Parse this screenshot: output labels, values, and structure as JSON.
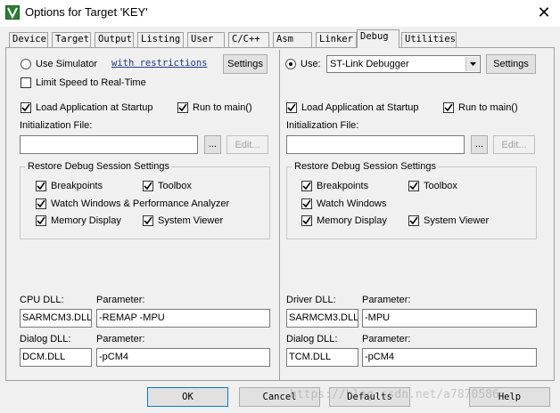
{
  "window": {
    "title": "Options for Target 'KEY'",
    "close_glyph": "✕"
  },
  "tabs": [
    {
      "label": "Device"
    },
    {
      "label": "Target"
    },
    {
      "label": "Output"
    },
    {
      "label": "Listing"
    },
    {
      "label": "User"
    },
    {
      "label": "C/C++"
    },
    {
      "label": "Asm"
    },
    {
      "label": "Linker"
    },
    {
      "label": "Debug"
    },
    {
      "label": "Utilities"
    }
  ],
  "active_tab": "Debug",
  "left": {
    "use_simulator_label": "Use Simulator",
    "use_simulator_selected": false,
    "restrictions_link": "with restrictions",
    "settings_label": "Settings",
    "limit_speed_label": "Limit Speed to Real-Time",
    "limit_speed_checked": false,
    "load_app_label": "Load Application at Startup",
    "load_app_checked": true,
    "run_to_main_label": "Run to main()",
    "run_to_main_checked": true,
    "init_file_label": "Initialization File:",
    "init_file_value": "",
    "browse_label": "...",
    "edit_label": "Edit...",
    "restore_title": "Restore Debug Session Settings",
    "breakpoints_label": "Breakpoints",
    "toolbox_label": "Toolbox",
    "watch_label": "Watch Windows & Performance Analyzer",
    "memory_label": "Memory Display",
    "system_viewer_label": "System Viewer",
    "cpu_dll_label": "CPU DLL:",
    "cpu_dll_value": "SARMCM3.DLL",
    "cpu_param_label": "Parameter:",
    "cpu_param_value": "-REMAP -MPU",
    "dialog_dll_label": "Dialog DLL:",
    "dialog_dll_value": "DCM.DLL",
    "dialog_param_label": "Parameter:",
    "dialog_param_value": "-pCM4"
  },
  "right": {
    "use_label": "Use:",
    "use_selected": true,
    "debugger_value": "ST-Link Debugger",
    "settings_label": "Settings",
    "load_app_label": "Load Application at Startup",
    "run_to_main_label": "Run to main()",
    "init_file_label": "Initialization File:",
    "init_file_value": "",
    "browse_label": "...",
    "edit_label": "Edit...",
    "restore_title": "Restore Debug Session Settings",
    "breakpoints_label": "Breakpoints",
    "toolbox_label": "Toolbox",
    "watch_label": "Watch Windows",
    "memory_label": "Memory Display",
    "system_viewer_label": "System Viewer",
    "driver_dll_label": "Driver DLL:",
    "driver_dll_value": "SARMCM3.DLL",
    "driver_param_label": "Parameter:",
    "driver_param_value": "-MPU",
    "dialog_dll_label": "Dialog DLL:",
    "dialog_dll_value": "TCM.DLL",
    "dialog_param_label": "Parameter:",
    "dialog_param_value": "-pCM4"
  },
  "footer": {
    "ok_label": "OK",
    "cancel_label": "Cancel",
    "defaults_label": "Defaults",
    "help_label": "Help",
    "watermark": "https://blog.csdn.net/a7870586"
  },
  "colors": {
    "dialog_bg": "#f0f0f0",
    "link": "#1a3a8f",
    "icon_green": "#2e7d32"
  }
}
